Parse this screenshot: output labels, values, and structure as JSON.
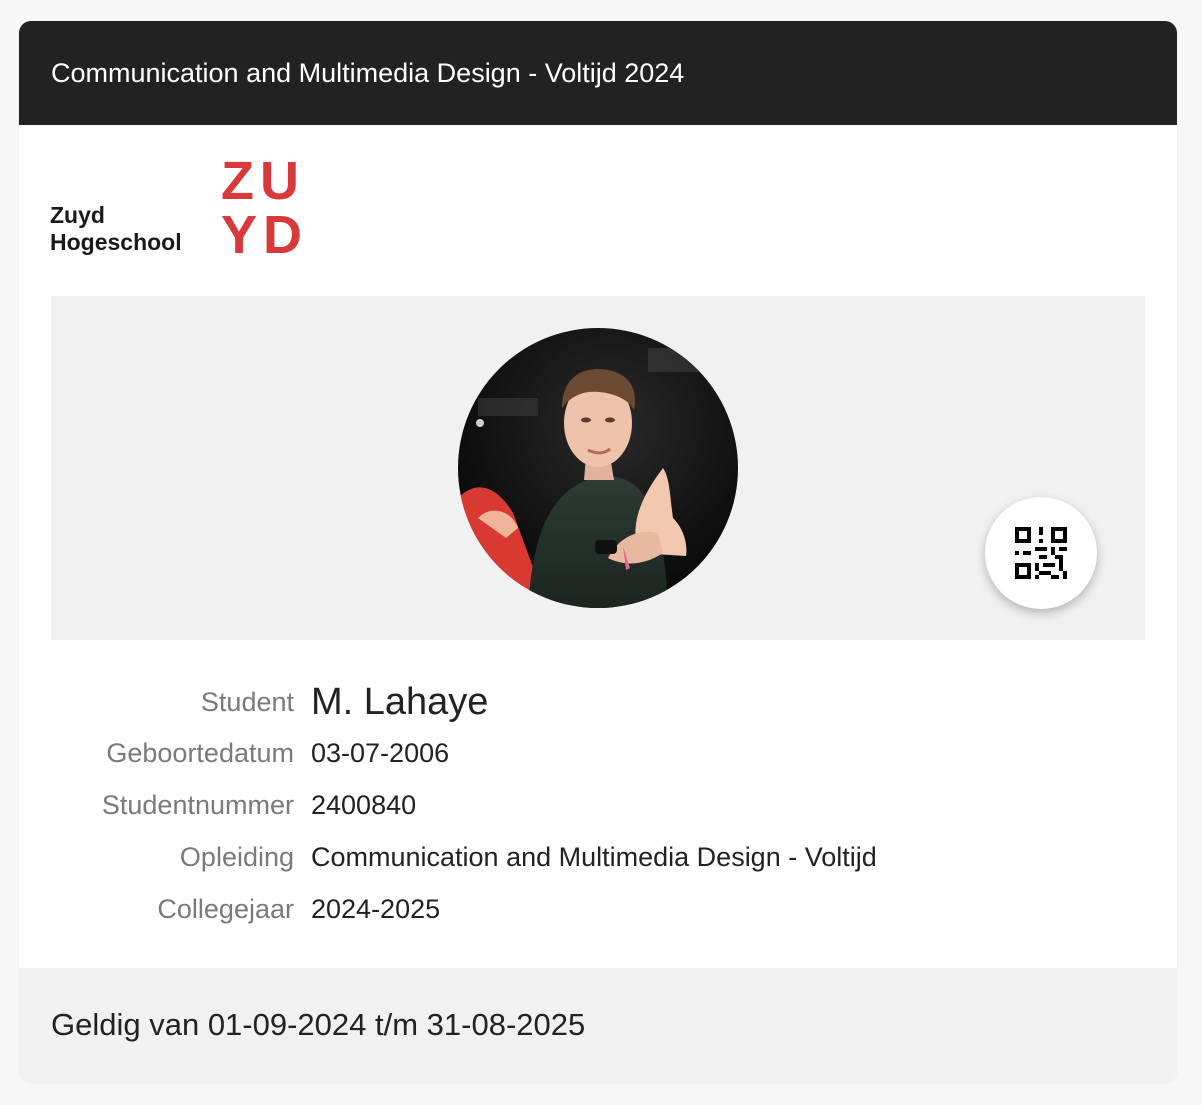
{
  "card": {
    "title": "Communication and Multimedia Design - Voltijd 2024"
  },
  "logo": {
    "name_line1": "Zuyd",
    "name_line2": "Hogeschool",
    "mark_line1": "ZU",
    "mark_line2": "YD",
    "brand_color": "#d8393a"
  },
  "photo": {
    "icon": "qr-code-icon"
  },
  "student": {
    "name_label": "Student",
    "name_value": "M. Lahaye",
    "dob_label": "Geboortedatum",
    "dob_value": "03-07-2006",
    "number_label": "Studentnummer",
    "number_value": "2400840",
    "program_label": "Opleiding",
    "program_value": "Communication and Multimedia Design - Voltijd",
    "year_label": "Collegejaar",
    "year_value": "2024-2025"
  },
  "footer": {
    "validity": "Geldig van 01-09-2024 t/m 31-08-2025"
  },
  "colors": {
    "header_bg": "#222222",
    "panel_bg": "#f1f1f1",
    "label": "#7a7a7a",
    "value": "#222222"
  }
}
